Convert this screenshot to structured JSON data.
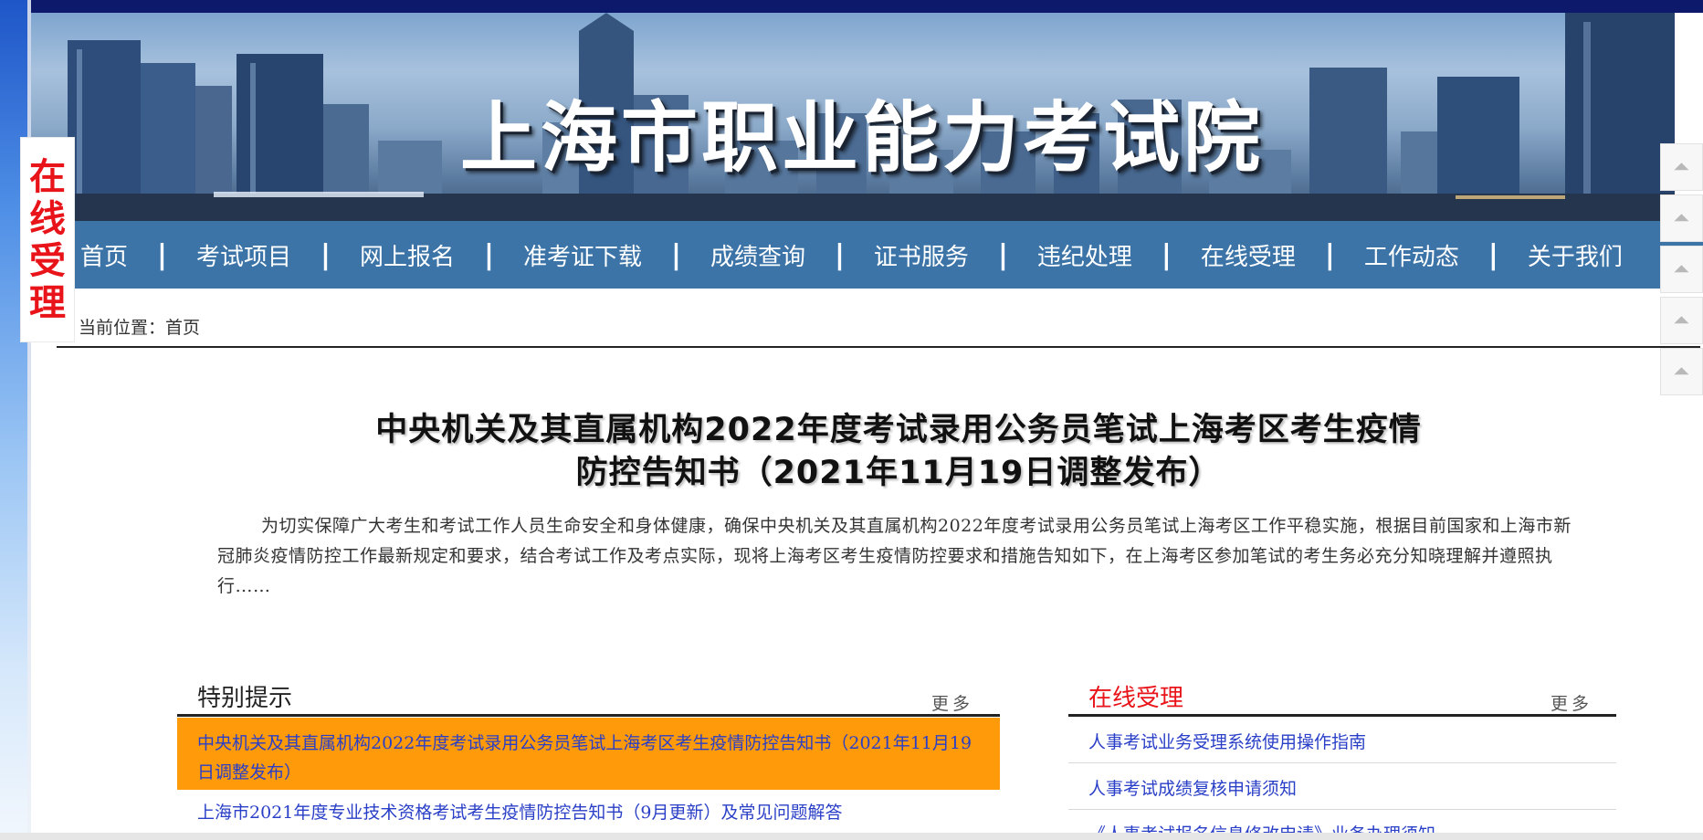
{
  "banner": {
    "title": "上海市职业能力考试院"
  },
  "side_tag": {
    "chars": [
      "在",
      "线",
      "受",
      "理"
    ]
  },
  "nav": {
    "items": [
      "首页",
      "考试项目",
      "网上报名",
      "准考证下载",
      "成绩查询",
      "证书服务",
      "违纪处理",
      "在线受理",
      "工作动态",
      "关于我们"
    ],
    "separator": "|"
  },
  "breadcrumb": "当前位置：首页",
  "scroll_buttons": [
    "up-arrow-icon",
    "up-arrow-icon",
    "up-arrow-icon",
    "up-arrow-icon",
    "up-arrow-icon"
  ],
  "article": {
    "title_line1": "中央机关及其直属机构2022年度考试录用公务员笔试上海考区考生疫情",
    "title_line2": "防控告知书（2021年11月19日调整发布）",
    "body": "为切实保障广大考生和考试工作人员生命安全和身体健康，确保中央机关及其直属机构2022年度考试录用公务员笔试上海考区工作平稳实施，根据目前国家和上海市新冠肺炎疫情防控工作最新规定和要求，结合考试工作及考点实际，现将上海考区考生疫情防控要求和措施告知如下，在上海考区参加笔试的考生务必充分知晓理解并遵照执行……"
  },
  "special_notice": {
    "title": "特别提示",
    "more": "更多",
    "items": [
      "中央机关及其直属机构2022年度考试录用公务员笔试上海考区考生疫情防控告知书（2021年11月19日调整发布）",
      "上海市2021年度专业技术资格考试考生疫情防控告知书（9月更新）及常见问题解答"
    ]
  },
  "online_service": {
    "title": "在线受理",
    "more": "更多",
    "items": [
      "人事考试业务受理系统使用操作指南",
      "人事考试成绩复核申请须知",
      "《人事考试报名信息修改申请》业务办理须知"
    ]
  },
  "colors": {
    "nav_bg": "#3c74a8",
    "highlight_bg": "#ff9a0b",
    "link": "#2a3fc7",
    "accent_red": "#e8141a",
    "top_bar": "#0d1a6b"
  }
}
